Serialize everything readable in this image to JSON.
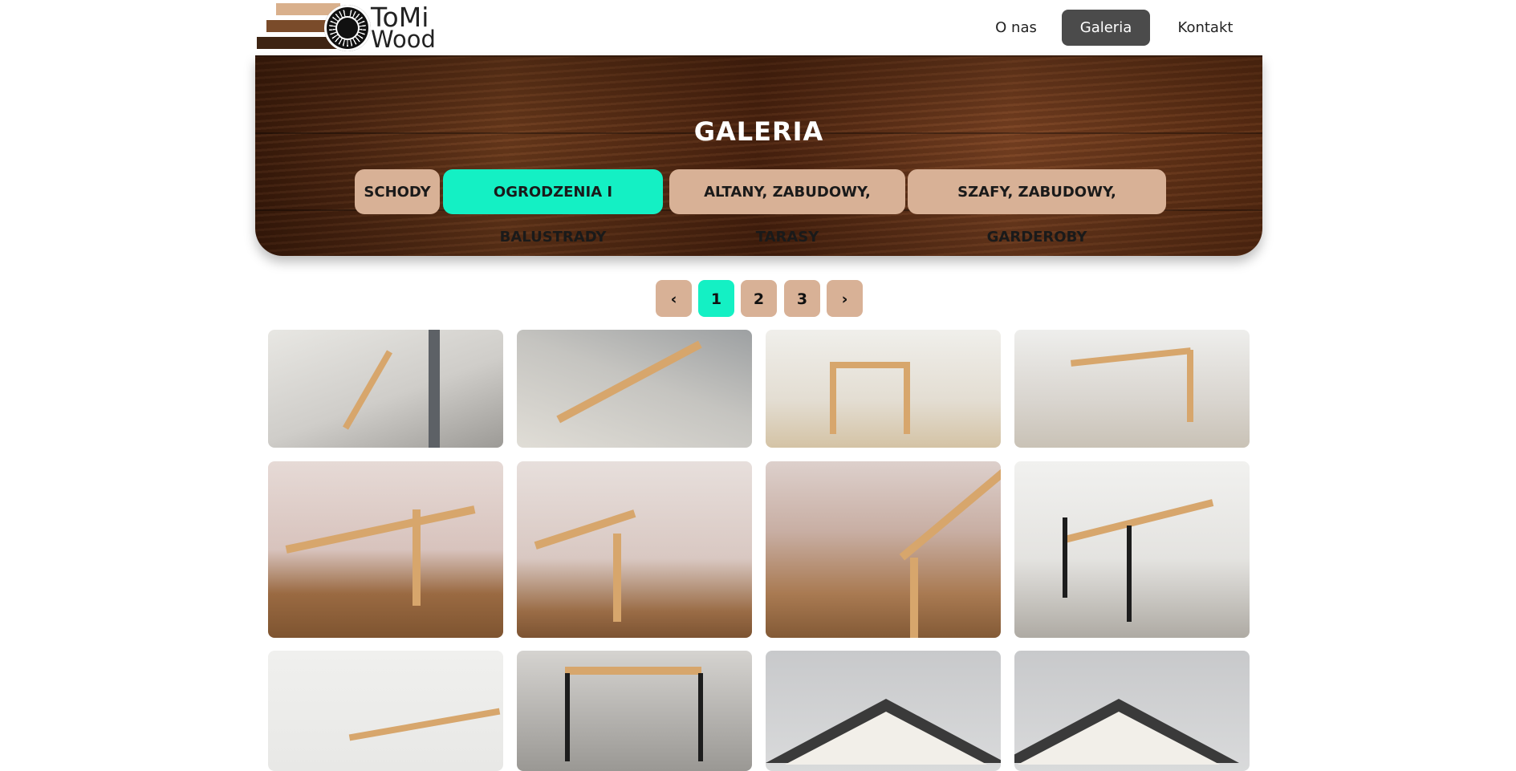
{
  "brand": {
    "line1": "ToMi",
    "line2": "Wood"
  },
  "nav": {
    "about": "O nas",
    "gallery": "Galeria",
    "contact": "Kontakt"
  },
  "hero": {
    "title": "GALERIA"
  },
  "categories": [
    {
      "label": "SCHODY",
      "active": false
    },
    {
      "label": "OGRODZENIA I BALUSTRADY",
      "active": true
    },
    {
      "label": "ALTANY, ZABUDOWY, TARASY",
      "active": false
    },
    {
      "label": "SZAFY, ZABUDOWY, GARDEROBY",
      "active": false
    }
  ],
  "pagination": {
    "prev": "‹",
    "pages": [
      "1",
      "2",
      "3"
    ],
    "current": "1",
    "next": "›"
  },
  "colors": {
    "accent": "#14f0c4",
    "button": "#d8b196",
    "nav_active": "#4b4b4b"
  },
  "gallery": {
    "photos_visible": 12
  }
}
